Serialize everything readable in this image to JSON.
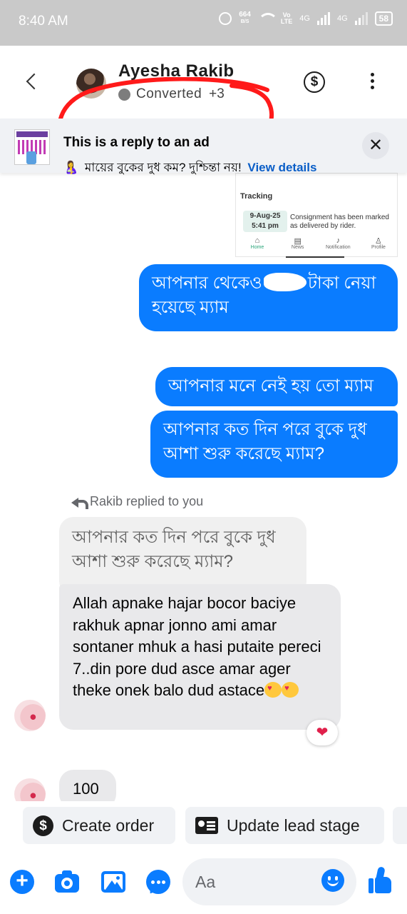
{
  "status_bar": {
    "time": "8:40 AM",
    "net_speed": "664",
    "net_unit": "B/S",
    "volte_top": "Vo",
    "volte_bottom": "LTE",
    "net1": "4G",
    "net2": "4G",
    "battery": "58"
  },
  "header": {
    "contact_name": "Ayesha Rakib",
    "status_label": "Converted",
    "status_extra": "+3",
    "dollar_symbol": "$",
    "annotation_color": "#ff1a1a"
  },
  "ad_banner": {
    "title": "This is a reply to an ad",
    "emoji": "🤱",
    "text": "মায়ের বুকের দুধ কম? দুশ্চিন্তা নয়!",
    "link": "View details",
    "close": "✕"
  },
  "shared_screenshot": {
    "title": "Tracking",
    "date": "9-Aug-25",
    "time": "5:41 pm",
    "note": "Consignment has been marked as delivered by rider.",
    "nav": [
      {
        "label": "Home",
        "icon": "home-icon",
        "glyph": "⌂"
      },
      {
        "label": "News",
        "icon": "news-icon",
        "glyph": "▤"
      },
      {
        "label": "Notification",
        "icon": "bell-icon",
        "glyph": "♪"
      },
      {
        "label": "Profile",
        "icon": "profile-icon",
        "glyph": "♙"
      }
    ]
  },
  "messages": {
    "out1_before": "আপনার থেকেও",
    "out1_after": "টাকা নেয়া হয়েছে ম্যাম",
    "out2": "আপনার মনে নেই হয় তো ম্যাম",
    "out3": "আপনার কত দিন পরে বুকে দুধ আশা শুরু করেছে ম্যাম?",
    "reply_label": "Rakib replied to you",
    "quoted": "আপনার কত দিন পরে বুকে দুধ আশা শুরু করেছে ম্যাম?",
    "in1": "Allah apnake hajar bocor baciye rakhuk apnar jonno ami amar sontaner mhuk a hasi putaite pereci 7..din pore dud asce amar ager theke onek balo dud astace",
    "reaction": "❤",
    "in2": "100"
  },
  "quick_actions": {
    "create_order": "Create order",
    "update_lead": "Update lead stage",
    "dollar_symbol": "$"
  },
  "composer": {
    "placeholder": "Aa",
    "plus": "+"
  },
  "colors": {
    "accent": "#0a7cff",
    "incoming_bubble": "#e9e9eb",
    "status_bar": "#c9c9c9",
    "link": "#0a5ec7"
  }
}
